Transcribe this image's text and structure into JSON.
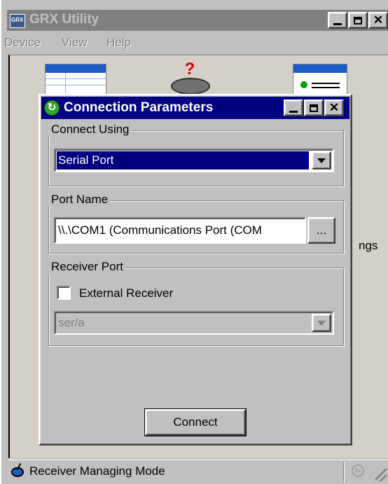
{
  "main_window": {
    "title": "GRX Utility",
    "app_logo_text": "GRX",
    "menu": [
      "Device",
      "View",
      "Help"
    ],
    "partial_label": "ngs",
    "status_text": "Receiver Managing Mode"
  },
  "dialog": {
    "title": "Connection Parameters",
    "connect_using": {
      "legend": "Connect Using",
      "selected": "Serial Port"
    },
    "port_name": {
      "legend": "Port Name",
      "value": "\\\\.\\COM1 (Communications Port (COM",
      "browse_label": "..."
    },
    "receiver_port": {
      "legend": "Receiver Port",
      "external_receiver_label": "External Receiver",
      "external_receiver_checked": false,
      "port_value": "ser/a"
    },
    "connect_button": "Connect"
  },
  "colors": {
    "titlebar_active": "#000080",
    "titlebar_inactive": "#808080",
    "face": "#c0c0c0"
  }
}
